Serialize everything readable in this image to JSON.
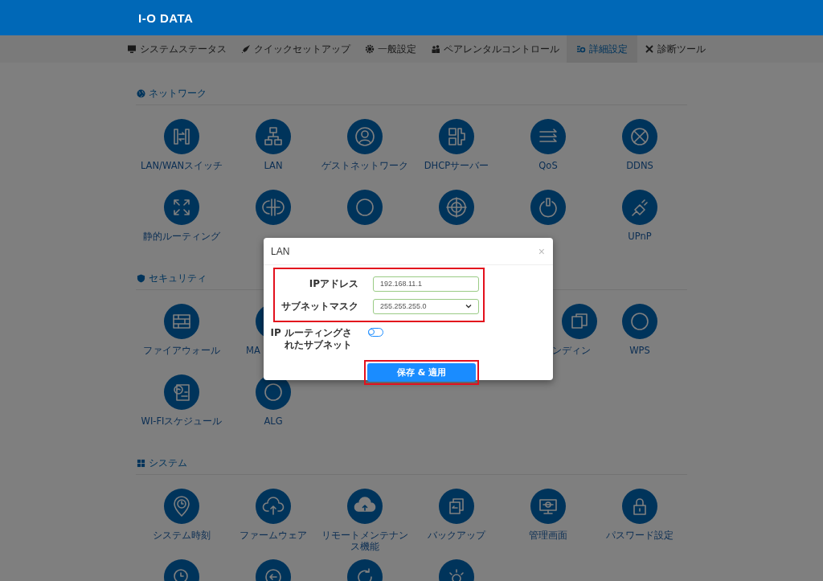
{
  "header": {
    "logo": "I-O DATA"
  },
  "nav": [
    {
      "label": "システムステータス",
      "selected": false
    },
    {
      "label": "クイックセットアップ",
      "selected": false
    },
    {
      "label": "一般設定",
      "selected": false
    },
    {
      "label": "ペアレンタルコントロール",
      "selected": false
    },
    {
      "label": "詳細設定",
      "selected": true
    },
    {
      "label": "診断ツール",
      "selected": false
    }
  ],
  "sections": [
    {
      "title": "ネットワーク",
      "items": [
        {
          "kind": "full",
          "label": "LAN/WANスイッチ"
        },
        {
          "kind": "full",
          "label": "LAN"
        },
        {
          "kind": "full",
          "label": "ゲストネットワーク"
        },
        {
          "kind": "full",
          "label": "DHCPサーバー"
        },
        {
          "kind": "full",
          "label": "QoS"
        },
        {
          "kind": "full",
          "label": "DDNS"
        },
        {
          "kind": "full",
          "label": "静的ルーティング"
        },
        {
          "kind": "no-label"
        },
        {
          "kind": "no-label"
        },
        {
          "kind": "no-label"
        },
        {
          "kind": "no-label"
        },
        {
          "kind": "full",
          "label": "UPnP"
        }
      ]
    },
    {
      "title": "セキュリティ",
      "items": [
        {
          "kind": "full",
          "label": "ファイアウォール"
        },
        {
          "kind": "cut-right",
          "label": "MA"
        },
        {
          "kind": "hidden"
        },
        {
          "kind": "hidden"
        },
        {
          "kind": "cut-left",
          "label": "ンディン"
        },
        {
          "kind": "full",
          "label": "WPS"
        },
        {
          "kind": "full",
          "label": "WI-FIスケジュール"
        },
        {
          "kind": "full",
          "label": "ALG"
        }
      ]
    },
    {
      "title": "システム",
      "items": [
        {
          "kind": "full",
          "label": "システム時刻"
        },
        {
          "kind": "full",
          "label": "ファームウェア"
        },
        {
          "kind": "full",
          "label": "リモートメンテナンス機能"
        },
        {
          "kind": "full",
          "label": "バックアップ"
        },
        {
          "kind": "full",
          "label": "管理画面"
        },
        {
          "kind": "full",
          "label": "パスワード設定"
        },
        {
          "kind": "no-label"
        },
        {
          "kind": "no-label"
        },
        {
          "kind": "no-label"
        },
        {
          "kind": "no-label"
        }
      ]
    }
  ],
  "dialog": {
    "title": "LAN",
    "close": "×",
    "fields": [
      {
        "kind": "text",
        "label": "IPアドレス",
        "value": "192.168.11.1",
        "highlight": true
      },
      {
        "kind": "select",
        "label": "サブネットマスク",
        "value": "255.255.255.0",
        "highlight": true
      },
      {
        "kind": "toggle",
        "label": "IP ルーティングされたサブネット",
        "on": false,
        "highlight": false
      }
    ],
    "button": {
      "label": "保存 & 適用",
      "highlight": true
    }
  }
}
